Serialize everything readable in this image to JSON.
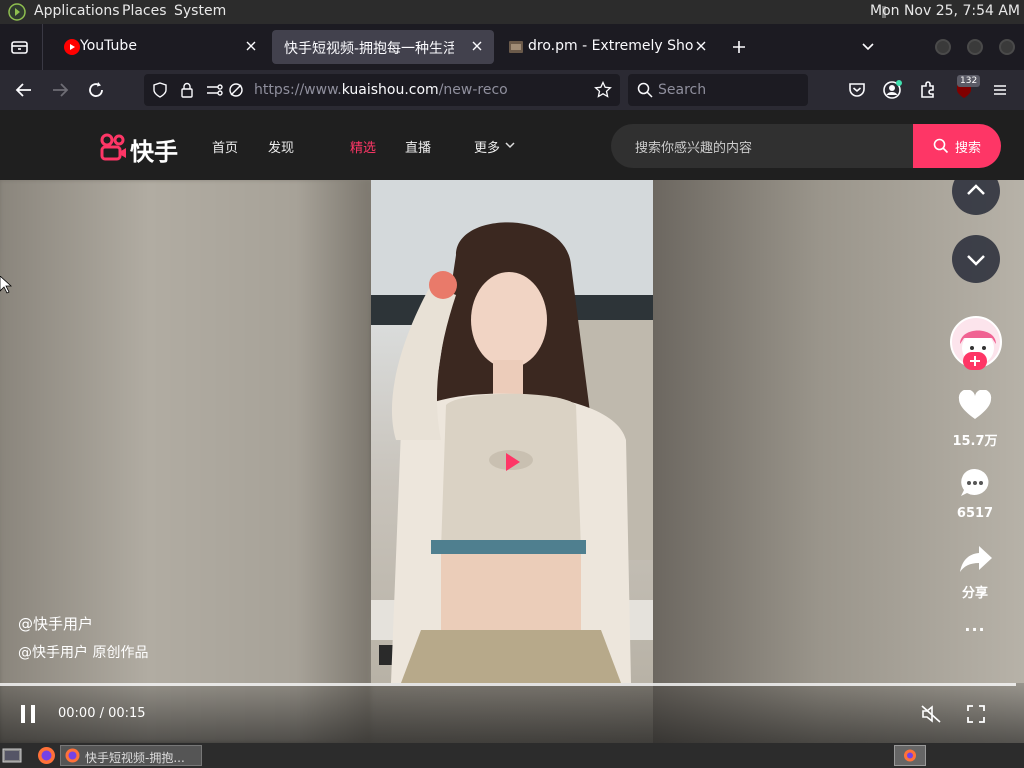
{
  "system_bar": {
    "menus": [
      "Applications",
      "Places",
      "System"
    ],
    "clock": "Mon Nov 25,  7:54 AM"
  },
  "tabs": [
    {
      "title": "YouTube",
      "icon": "youtube-icon",
      "active": false
    },
    {
      "title": "快手短视频-拥抱每一种生活",
      "icon": "kuaishou-icon",
      "active": true
    },
    {
      "title": "dro.pm - Extremely Short Li",
      "icon": "dropm-icon",
      "active": false
    }
  ],
  "navbar": {
    "url_prefix": "https://www.",
    "url_domain": "kuaishou.com",
    "url_path": "/new-reco",
    "search_placeholder": "Search",
    "extension_badge": "132"
  },
  "site": {
    "logo_text": "快手",
    "nav_items": [
      "首页",
      "发现",
      "精选",
      "直播",
      "更多"
    ],
    "search_placeholder": "搜索你感兴趣的内容",
    "search_button": "搜索"
  },
  "video": {
    "likes": "15.7万",
    "comments": "6517",
    "share_label": "分享",
    "more_label": "···",
    "author_line1": "@快手用户",
    "author_line2": "@快手用户 原创作品",
    "time": "00:00 / 00:15",
    "progress": 0.0
  },
  "taskbar": {
    "task_label": "快手短视频-拥抱..."
  },
  "colors": {
    "brand": "#fe3666",
    "tab_active": "#42414d",
    "toolbar": "#2b2a33"
  }
}
